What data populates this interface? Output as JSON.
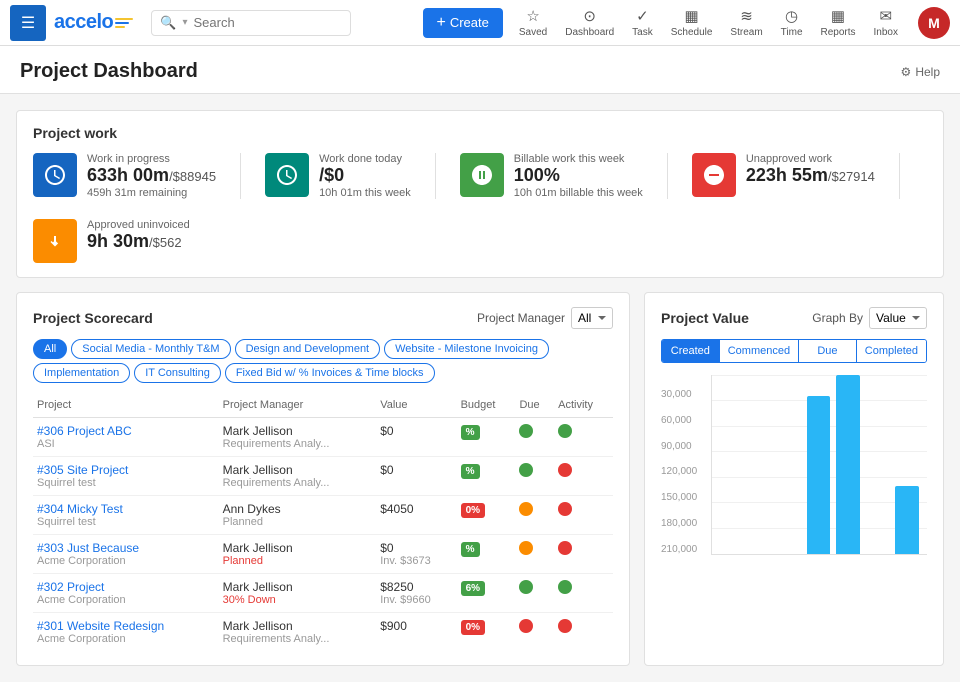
{
  "nav": {
    "logo_text": "accelo",
    "search_placeholder": "Search",
    "create_label": "Create",
    "actions": [
      {
        "name": "saved",
        "icon": "☆",
        "label": "Saved"
      },
      {
        "name": "dashboard",
        "icon": "⊙",
        "label": "Dashboard"
      },
      {
        "name": "task",
        "icon": "✓",
        "label": "Task"
      },
      {
        "name": "schedule",
        "icon": "▦",
        "label": "Schedule"
      },
      {
        "name": "stream",
        "icon": "≋",
        "label": "Stream"
      },
      {
        "name": "time",
        "icon": "◷",
        "label": "Time"
      },
      {
        "name": "reports",
        "icon": "▦",
        "label": "Reports"
      },
      {
        "name": "inbox",
        "icon": "✉",
        "label": "Inbox"
      }
    ],
    "avatar_letter": "M"
  },
  "page": {
    "title": "Project Dashboard",
    "help_label": "Help"
  },
  "project_work": {
    "title": "Project work",
    "metrics": [
      {
        "id": "in_progress",
        "icon_color": "blue",
        "icon": "⏱",
        "label": "Work in progress",
        "value": "633h 00m",
        "value_suffix": "/$88945",
        "sub": "459h 31m remaining"
      },
      {
        "id": "done_today",
        "icon_color": "teal",
        "icon": "◷",
        "label": "Work done today",
        "value": "/$0",
        "value_prefix": "",
        "sub": "10h 01m this week"
      },
      {
        "id": "billable",
        "icon_color": "green",
        "icon": "↗",
        "label": "Billable work this week",
        "value": "100%",
        "sub": "10h 01m billable this week"
      },
      {
        "id": "unapproved",
        "icon_color": "red",
        "icon": "⊖",
        "label": "Unapproved work",
        "value": "223h 55m",
        "value_suffix": "/$27914",
        "sub": ""
      },
      {
        "id": "approved",
        "icon_color": "orange",
        "icon": "⊕",
        "label": "Approved uninvoiced",
        "value": "9h 30m",
        "value_suffix": "/$562",
        "sub": ""
      }
    ]
  },
  "scorecard": {
    "title": "Project Scorecard",
    "pm_label": "Project Manager",
    "pm_value": "All",
    "filter_tabs": [
      {
        "label": "All",
        "active": true
      },
      {
        "label": "Social Media - Monthly T&M",
        "active": false
      },
      {
        "label": "Design and Development",
        "active": false
      },
      {
        "label": "Website - Milestone Invoicing",
        "active": false
      },
      {
        "label": "Implementation",
        "active": false
      },
      {
        "label": "IT Consulting",
        "active": false
      },
      {
        "label": "Fixed Bid w/ % Invoices & Time blocks",
        "active": false
      }
    ],
    "table": {
      "columns": [
        "Project",
        "Project Manager",
        "Value",
        "Budget",
        "Due",
        "Activity"
      ],
      "rows": [
        {
          "id": "#306 Project ABC",
          "sub": "ASI",
          "pm": "Mark Jellison",
          "pm_sub": "Requirements Analy...",
          "value": "$0",
          "budget": "%",
          "budget_color": "green",
          "due": "green",
          "activity": "green"
        },
        {
          "id": "#305 Site Project",
          "sub": "Squirrel test",
          "pm": "Mark Jellison",
          "pm_sub": "Requirements Analy...",
          "value": "$0",
          "budget": "%",
          "budget_color": "green",
          "due": "green",
          "activity": "red"
        },
        {
          "id": "#304 Micky Test",
          "sub": "Squirrel test",
          "pm": "Ann Dykes",
          "pm_sub": "Planned",
          "pm_sub_color": "normal",
          "value": "$4050",
          "budget": "0%",
          "budget_color": "red",
          "due": "orange",
          "activity": "red"
        },
        {
          "id": "#303 Just Because",
          "sub": "Acme Corporation",
          "pm": "Mark Jellison",
          "pm_sub": "Planned",
          "pm_sub_color": "red",
          "value": "$0",
          "value_sub": "Inv. $3673",
          "budget": "%",
          "budget_color": "green",
          "due": "orange",
          "activity": "red"
        },
        {
          "id": "#302 Project",
          "sub": "Acme Corporation",
          "pm": "Mark Jellison",
          "pm_sub": "30% Down",
          "pm_sub_color": "red",
          "value": "$8250",
          "value_sub": "Inv. $9660",
          "budget": "6%",
          "budget_color": "green",
          "due": "green",
          "activity": "green"
        },
        {
          "id": "#301 Website Redesign",
          "sub": "Acme Corporation",
          "pm": "Mark Jellison",
          "pm_sub": "Requirements Analy...",
          "value": "$900",
          "budget": "0%",
          "budget_color": "red",
          "due": "red",
          "activity": "red"
        }
      ]
    }
  },
  "project_value": {
    "title": "Project Value",
    "graph_by_label": "Graph By",
    "graph_by_value": "Value",
    "tabs": [
      {
        "label": "Created",
        "active": true
      },
      {
        "label": "Commenced",
        "active": false
      },
      {
        "label": "Due",
        "active": false
      },
      {
        "label": "Completed",
        "active": false
      }
    ],
    "y_labels": [
      "210,000",
      "180,000",
      "150,000",
      "120,000",
      "90,000",
      "60,000",
      "30,000",
      ""
    ],
    "bars": [
      {
        "height_pct": 0,
        "label": ""
      },
      {
        "height_pct": 0,
        "label": ""
      },
      {
        "height_pct": 0,
        "label": ""
      },
      {
        "height_pct": 88,
        "label": ""
      },
      {
        "height_pct": 100,
        "label": ""
      },
      {
        "height_pct": 0,
        "label": ""
      },
      {
        "height_pct": 38,
        "label": ""
      }
    ]
  }
}
